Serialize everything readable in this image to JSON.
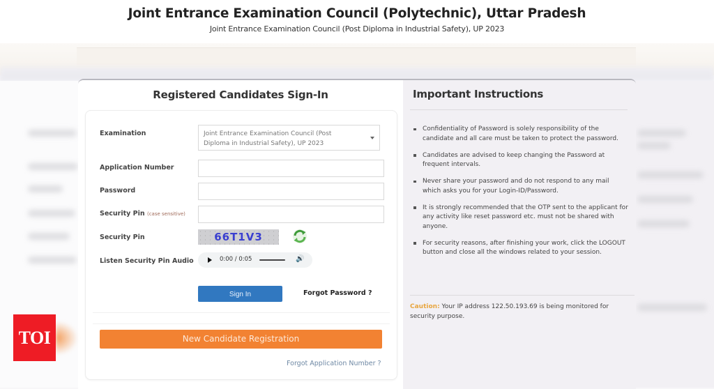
{
  "header": {
    "title": "Joint Entrance Examination Council (Polytechnic), Uttar Pradesh",
    "subtitle": "Joint Entrance Examination Council (Post Diploma in Industrial Safety), UP 2023"
  },
  "signin": {
    "heading": "Registered Candidates Sign-In",
    "fields": {
      "examination": {
        "label": "Examination",
        "selected": "Joint Entrance Examination Council (Post Diploma in Industrial Safety), UP 2023"
      },
      "application_number": {
        "label": "Application Number",
        "value": "",
        "placeholder": ""
      },
      "password": {
        "label": "Password",
        "value": "",
        "placeholder": ""
      },
      "security_pin_input": {
        "label": "Security Pin",
        "hint": "(case sensitive)",
        "value": ""
      },
      "security_pin_image": {
        "label": "Security Pin",
        "captcha_text": "66T1V3"
      },
      "audio": {
        "label": "Listen Security Pin Audio",
        "time": "0:00 / 0:05"
      }
    },
    "buttons": {
      "sign_in": "Sign In",
      "forgot_password": "Forgot Password ?",
      "new_registration": "New Candidate Registration",
      "forgot_application_number": "Forgot Application Number ?"
    }
  },
  "instructions": {
    "heading": "Important Instructions",
    "items": [
      "Confidentiality of Password is solely responsibility of the candidate and all care must be taken to protect the password.",
      "Candidates are advised to keep changing the Password at frequent intervals.",
      "Never share your password and do not respond to any mail which asks you for your Login-ID/Password.",
      "It is strongly recommended that the OTP sent to the applicant for any activity like reset password etc. must not be shared with anyone.",
      "For security reasons, after finishing your work, click the LOGOUT button and close all the windows related to your session."
    ],
    "caution": {
      "tag": "Caution:",
      "text": " Your IP address 122.50.193.69 is being monitored for security purpose."
    }
  },
  "watermark": {
    "logo_text": "TOI"
  },
  "colors": {
    "sign_in_button": "#3178c0",
    "registration_button": "#f28232",
    "caution_tag": "#e8a640",
    "captcha_text": "#3a3fd0",
    "logo_bg": "#ee1c25"
  }
}
